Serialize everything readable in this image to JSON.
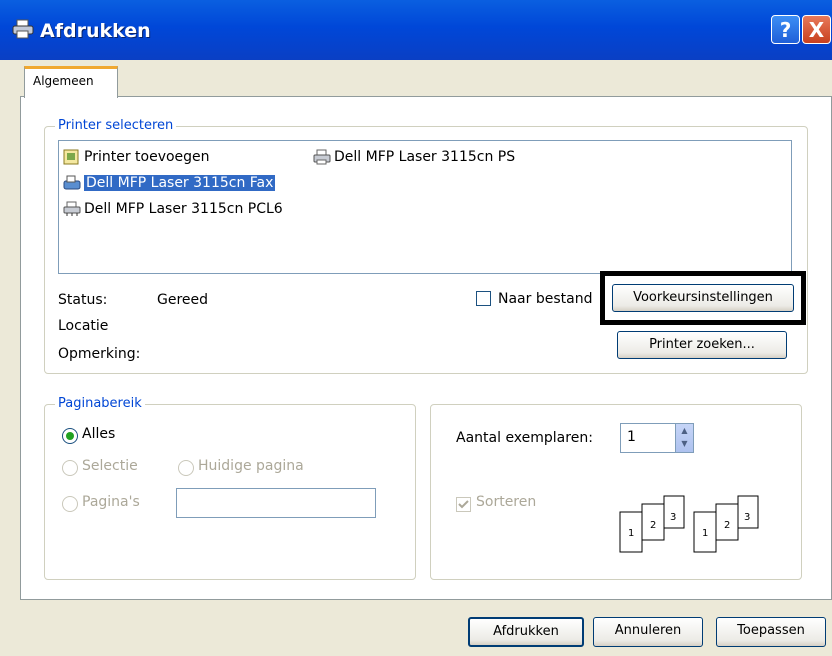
{
  "window": {
    "title": "Afdrukken",
    "help_label": "?",
    "close_label": "X"
  },
  "tabs": [
    {
      "label": "Algemeen",
      "active": true
    }
  ],
  "printer_select": {
    "group_label": "Printer selecteren",
    "printers": [
      {
        "label": "Printer toevoegen",
        "icon": "add-printer-icon",
        "selected": false
      },
      {
        "label": "Dell MFP Laser 3115cn PS",
        "icon": "printer-icon",
        "selected": false
      },
      {
        "label": "Dell MFP Laser 3115cn Fax",
        "icon": "fax-printer-icon",
        "selected": true
      },
      {
        "label": "Dell MFP Laser 3115cn PCL6",
        "icon": "network-printer-icon",
        "selected": false
      }
    ],
    "status_label": "Status:",
    "status_value": "Gereed",
    "location_label": "Locatie",
    "comment_label": "Opmerking:",
    "print_to_file_label": "Naar bestand",
    "print_to_file_checked": false,
    "preferences_button": "Voorkeursinstellingen",
    "find_printer_button": "Printer zoeken..."
  },
  "page_range": {
    "group_label": "Paginabereik",
    "all_label": "Alles",
    "selection_label": "Selectie",
    "current_page_label": "Huidige pagina",
    "pages_label": "Pagina's",
    "pages_value": "",
    "selected_option": "Alles"
  },
  "copies": {
    "label": "Aantal exemplaren:",
    "value": "1",
    "collate_label": "Sorteren",
    "collate_checked": true,
    "collate_pages": [
      "1",
      "2",
      "3"
    ]
  },
  "footer": {
    "print_button": "Afdrukken",
    "cancel_button": "Annuleren",
    "apply_button": "Toepassen"
  },
  "colors": {
    "titlebar": "#0047d8",
    "selection": "#316ac5",
    "group_label": "#0046d5",
    "tab_accent": "#f0a830"
  }
}
